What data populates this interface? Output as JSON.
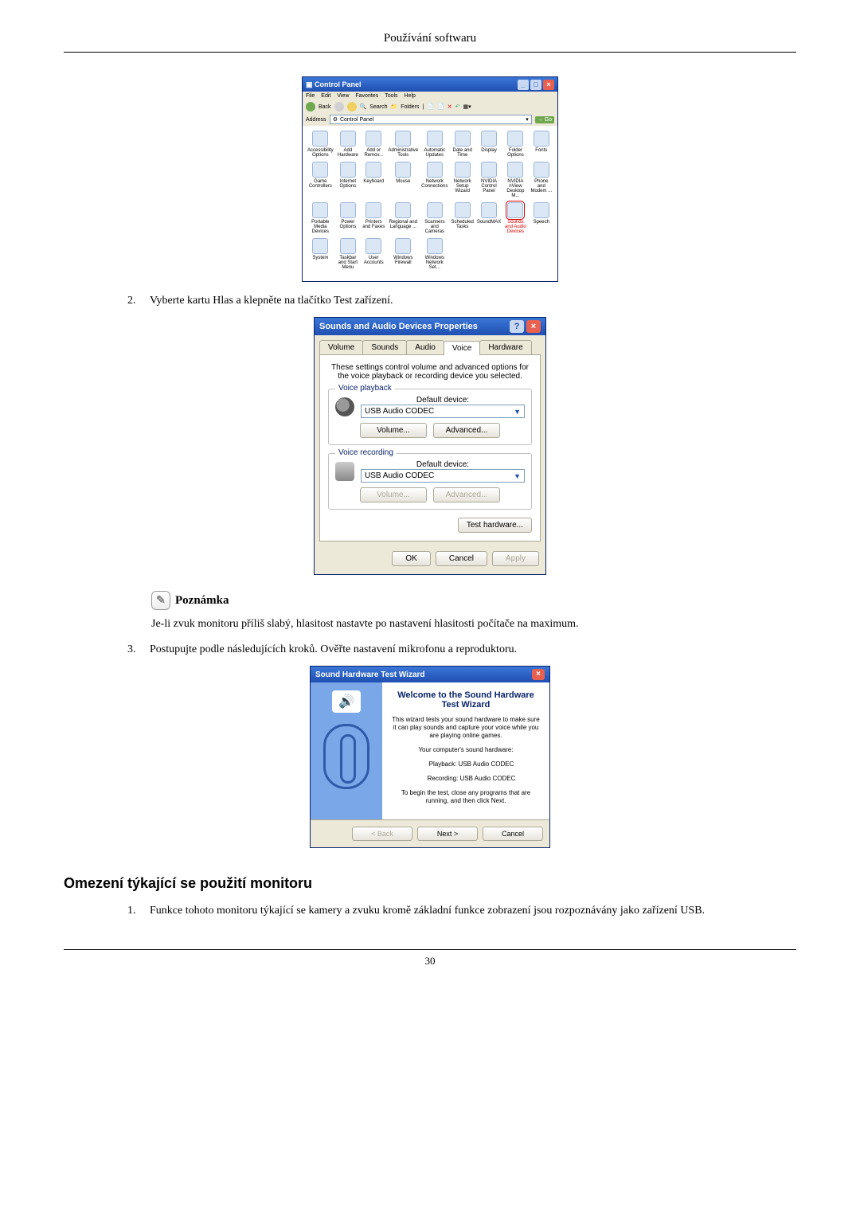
{
  "page": {
    "header": "Používání softwaru",
    "page_number": "30"
  },
  "steps": {
    "s2_num": "2.",
    "s2_txt": "Vyberte kartu Hlas a klepněte na tlačítko Test zařízení.",
    "s3_num": "3.",
    "s3_txt": "Postupujte podle následujících kroků. Ověřte nastavení mikrofonu a reproduktoru.",
    "limit1_num": "1.",
    "limit1_txt": "Funkce tohoto monitoru týkající se kamery a zvuku kromě základní funkce zobrazení jsou rozpoznávány jako zařízení USB."
  },
  "note": {
    "heading": "Poznámka",
    "body": "Je-li zvuk monitoru příliš slabý, hlasitost nastavte po nastavení hlasitosti počítače na maximum."
  },
  "section_heading": "Omezení týkající se použití monitoru",
  "cp": {
    "title": "Control Panel",
    "menu": [
      "File",
      "Edit",
      "View",
      "Favorites",
      "Tools",
      "Help"
    ],
    "back": "Back",
    "search": "Search",
    "folders": "Folders",
    "addr_label": "Address",
    "addr_value": "Control Panel",
    "go": "Go",
    "items": [
      "Accessibility Options",
      "Add Hardware",
      "Add or Remov...",
      "Administrative Tools",
      "Automatic Updates",
      "Date and Time",
      "Display",
      "Folder Options",
      "Fonts",
      "Game Controllers",
      "Internet Options",
      "Keyboard",
      "Mouse",
      "Network Connections",
      "Network Setup Wizard",
      "NVIDIA Control Panel",
      "NVIDIA nView Desktop M...",
      "Phone and Modem ...",
      "Portable Media Devices",
      "Power Options",
      "Printers and Faxes",
      "Regional and Language ...",
      "Scanners and Cameras",
      "Scheduled Tasks",
      "SoundMAX",
      "Sounds and Audio Devices",
      "Speech",
      "System",
      "Taskbar and Start Menu",
      "User Accounts",
      "Windows Firewall",
      "Windows Network Set..."
    ],
    "selected_index": 25
  },
  "dlg": {
    "title": "Sounds and Audio Devices Properties",
    "tabs": [
      "Volume",
      "Sounds",
      "Audio",
      "Voice",
      "Hardware"
    ],
    "active_tab": 3,
    "desc": "These settings control volume and advanced options for the voice playback or recording device you selected.",
    "grp1": "Voice playback",
    "grp2": "Voice recording",
    "default_label": "Default device:",
    "device": "USB Audio CODEC",
    "btn_volume": "Volume...",
    "btn_advanced": "Advanced...",
    "btn_test": "Test hardware...",
    "ok": "OK",
    "cancel": "Cancel",
    "apply": "Apply"
  },
  "wiz": {
    "title": "Sound Hardware Test Wizard",
    "heading": "Welcome to the Sound Hardware Test Wizard",
    "p1": "This wizard tests your sound hardware to make sure it can play sounds and capture your voice while you are playing online games.",
    "p2": "Your computer's sound hardware:",
    "p3": "Playback: USB Audio CODEC",
    "p4": "Recording: USB Audio CODEC",
    "p5": "To begin the test, close any programs that are running, and then click Next.",
    "back": "< Back",
    "next": "Next >",
    "cancel": "Cancel"
  }
}
